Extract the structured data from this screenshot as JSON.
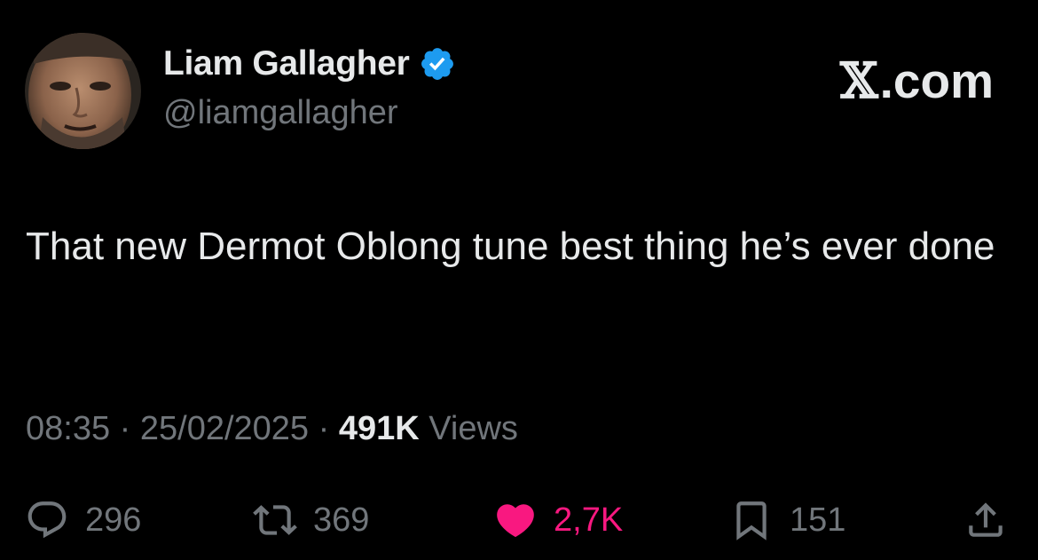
{
  "author": {
    "display_name": "Liam Gallagher",
    "handle": "@liamgallagher",
    "verified": true,
    "avatar_icon": "avatar-photo"
  },
  "brand": {
    "x_glyph": "𝕏",
    "label": ".com"
  },
  "tweet": {
    "text": "That new Dermot Oblong tune best thing he’s ever done"
  },
  "meta": {
    "time": "08:35",
    "sep1": " · ",
    "date": "25/02/2025",
    "sep2": " · ",
    "views_count": "491K",
    "views_label": " Views"
  },
  "actions": {
    "reply": {
      "icon": "reply-icon",
      "count": "296"
    },
    "retweet": {
      "icon": "retweet-icon",
      "count": "369"
    },
    "like": {
      "icon": "heart-icon",
      "count": "2,7K",
      "liked": true
    },
    "bookmark": {
      "icon": "bookmark-icon",
      "count": "151"
    },
    "share": {
      "icon": "share-icon"
    }
  },
  "colors": {
    "background": "#000000",
    "text_primary": "#e7e9ea",
    "text_secondary": "#71767b",
    "like_pink": "#f91880",
    "verified_blue": "#1d9bf0"
  }
}
